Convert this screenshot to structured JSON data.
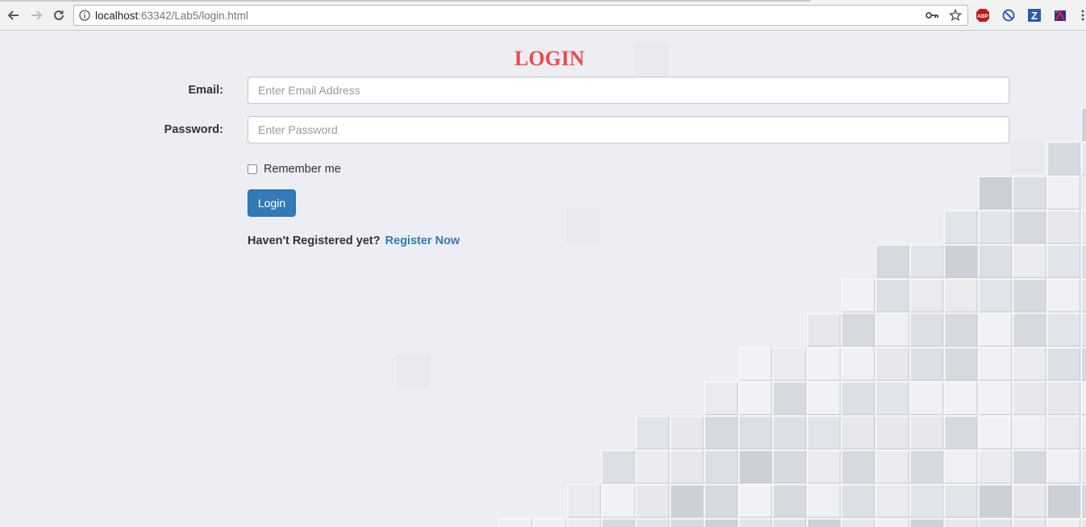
{
  "browser": {
    "url_host": "localhost",
    "url_rest": ":63342/Lab5/login.html",
    "extensions": {
      "abp_label": "ABP",
      "z_label": "Z"
    }
  },
  "page": {
    "title": "LOGIN",
    "email": {
      "label": "Email:",
      "placeholder": "Enter Email Address",
      "value": ""
    },
    "password": {
      "label": "Password:",
      "placeholder": "Enter Password",
      "value": ""
    },
    "remember": {
      "label": "Remember me",
      "checked": false
    },
    "login_button": "Login",
    "register_prompt": "Haven't Registered yet?",
    "register_link": "Register Now"
  },
  "colors": {
    "title": "#ee4b4b",
    "primary_button": "#337ab7",
    "link": "#337ab7",
    "page_bg": "#eceef3"
  }
}
